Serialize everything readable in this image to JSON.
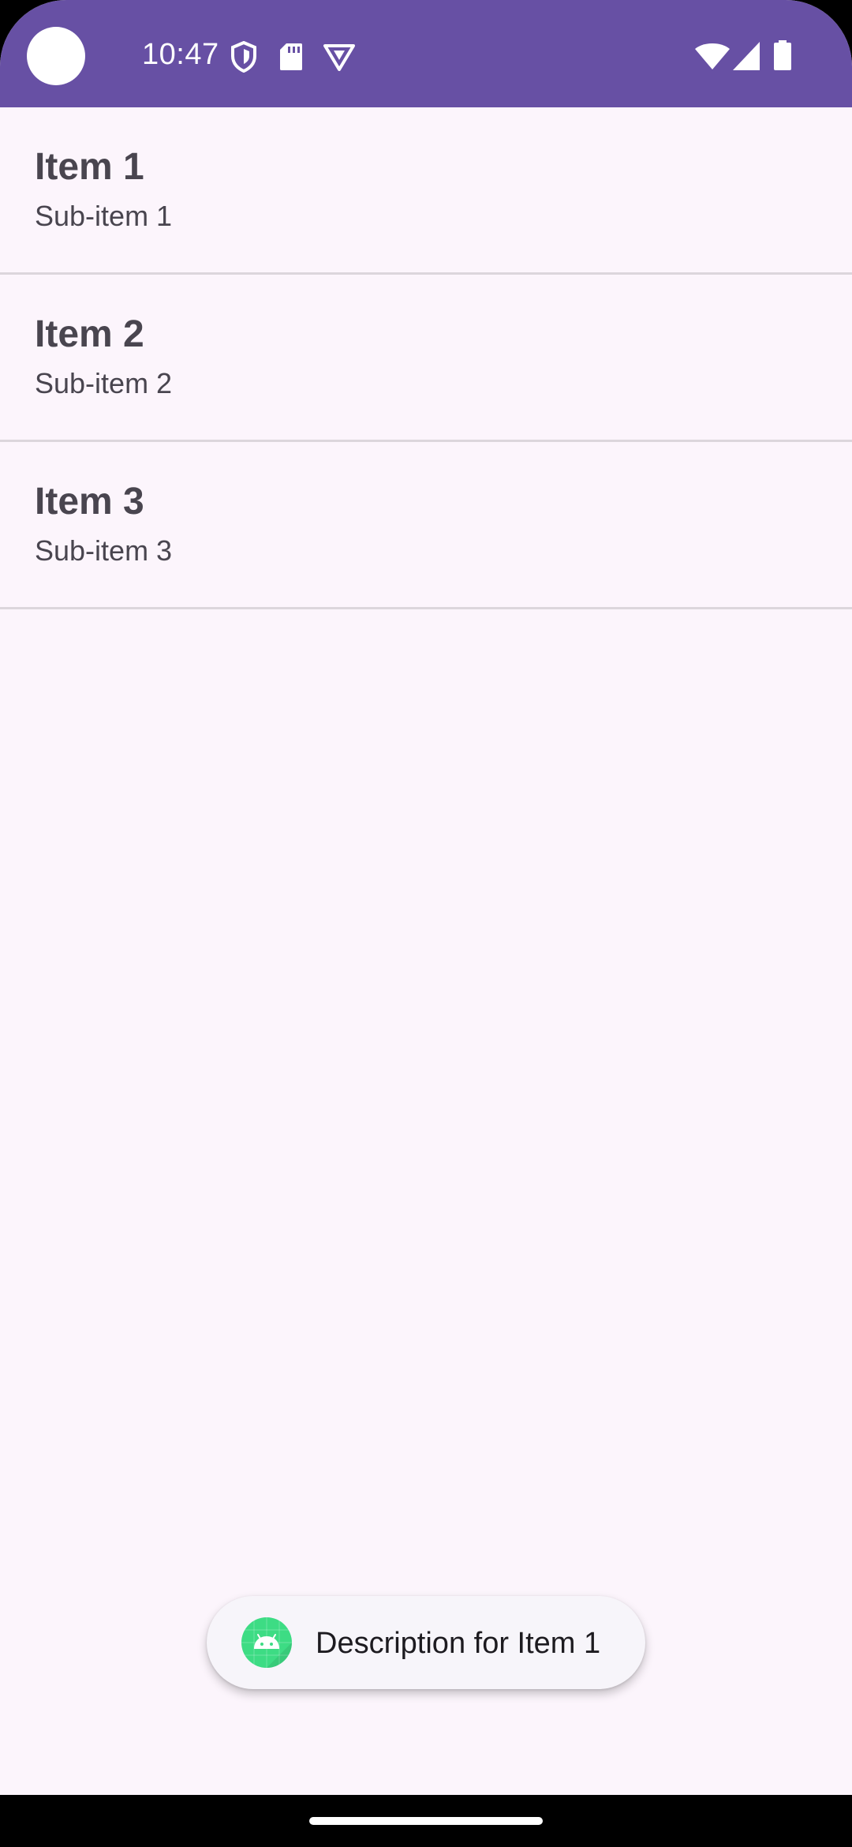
{
  "status_bar": {
    "time": "10:47",
    "background_color": "#6750a4",
    "left_icons": [
      "privacy-shield-icon",
      "sd-card-icon",
      "vpn-badge-icon"
    ],
    "right_icons": [
      "wifi-icon",
      "cell-signal-icon",
      "battery-icon"
    ]
  },
  "list": {
    "items": [
      {
        "title": "Item 1",
        "subtitle": "Sub-item 1"
      },
      {
        "title": "Item 2",
        "subtitle": "Sub-item 2"
      },
      {
        "title": "Item 3",
        "subtitle": "Sub-item 3"
      }
    ]
  },
  "toast": {
    "message": "Description for Item 1",
    "icon": "android-app-icon"
  },
  "colors": {
    "app_background": "#fcf5fc",
    "accent": "#6750a4",
    "text": "#49454f",
    "divider": "#dcd6dc",
    "android_green": "#3ddc84"
  },
  "navigation": {
    "type": "gesture",
    "icon": "home-indicator"
  }
}
